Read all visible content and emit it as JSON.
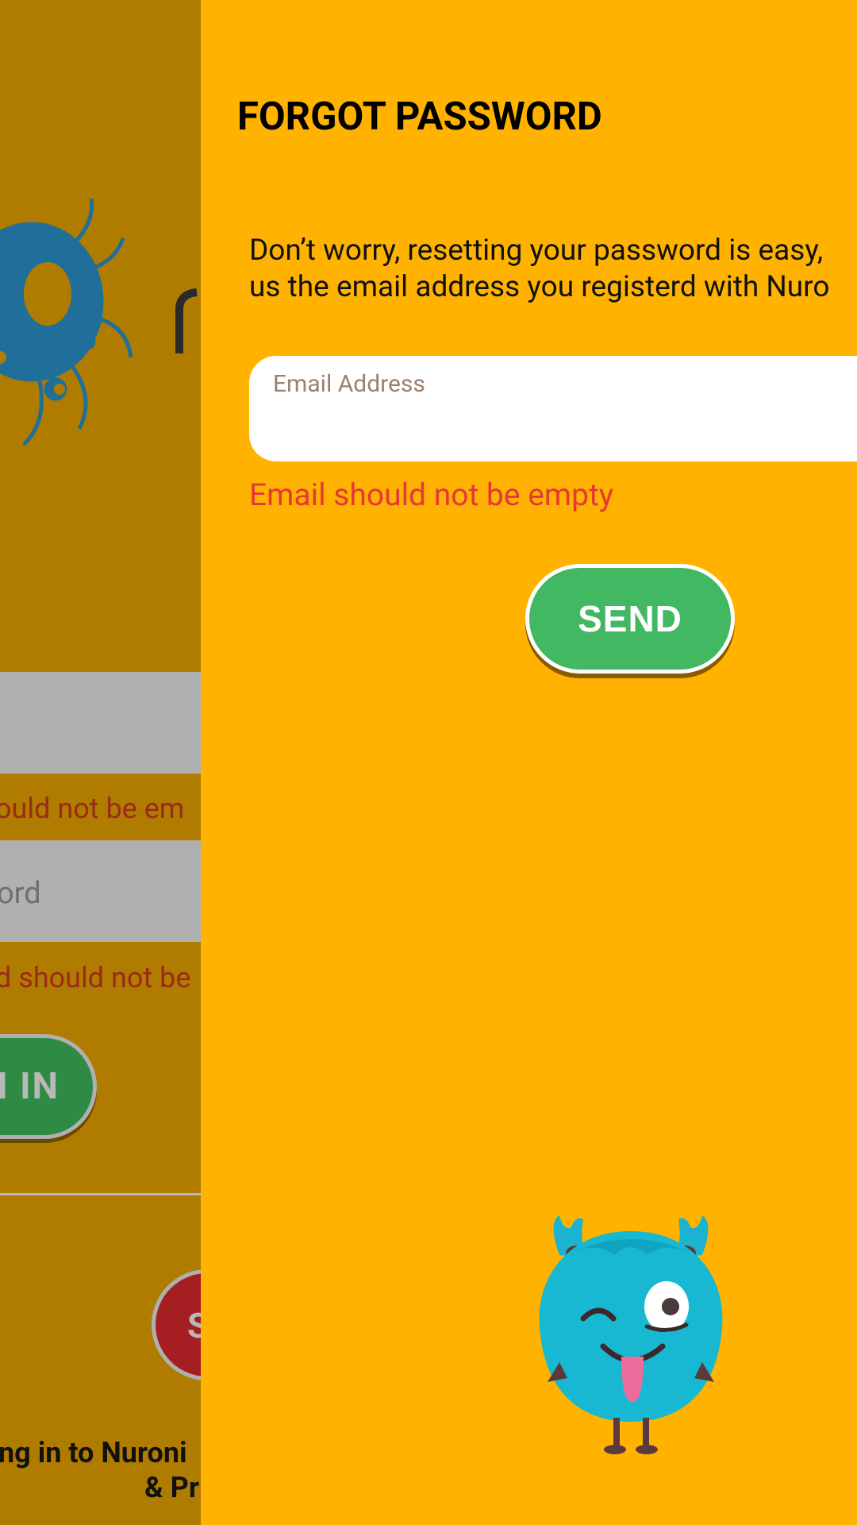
{
  "background_screen": {
    "email_error": "ould not be em",
    "password_placeholder": "ord",
    "password_error": "d should not be",
    "signin_label": "I IN",
    "signup_label": "S",
    "footer_line1": "ng in to Nuroni",
    "footer_line2": "& Pr"
  },
  "dialog": {
    "title": "FORGOT PASSWORD",
    "description_line1": "Don’t worry, resetting your password is easy,",
    "description_line2": "us the email address you registerd with Nuro",
    "email_label": "Email Address",
    "email_value": "",
    "email_error": "Email should not be empty",
    "send_label": "SEND"
  },
  "colors": {
    "drawer_bg": "#ffb300",
    "dim_bg": "#b07c00",
    "send_button": "#43b862",
    "error_text": "#e53935"
  }
}
